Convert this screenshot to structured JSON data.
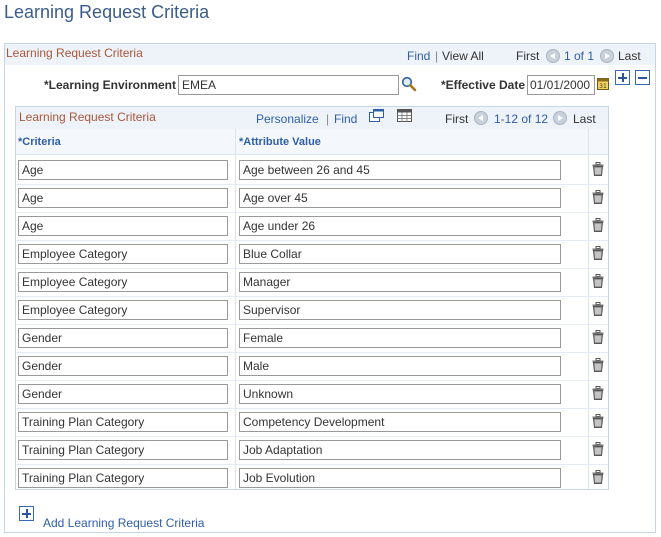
{
  "page": {
    "title": "Learning Request Criteria"
  },
  "outer": {
    "title": "Learning Request Criteria",
    "find": "Find",
    "separator": "|",
    "view_all": "View All",
    "first": "First",
    "range": "1 of 1",
    "last": "Last"
  },
  "fields": {
    "learning_environment_label": "*Learning Environment",
    "learning_environment_value": "EMEA",
    "effective_date_label": "*Effective Date",
    "effective_date_value": "01/01/2000"
  },
  "grid": {
    "title": "Learning Request Criteria",
    "personalize": "Personalize",
    "separator": "|",
    "find": "Find",
    "first": "First",
    "range": "1-12 of 12",
    "last": "Last",
    "col_criteria": "*Criteria",
    "col_attribute": "*Attribute Value",
    "rows": [
      {
        "criteria": "Age",
        "attribute": "Age between 26 and 45"
      },
      {
        "criteria": "Age",
        "attribute": "Age over 45"
      },
      {
        "criteria": "Age",
        "attribute": "Age under 26"
      },
      {
        "criteria": "Employee Category",
        "attribute": "Blue Collar"
      },
      {
        "criteria": "Employee Category",
        "attribute": "Manager"
      },
      {
        "criteria": "Employee Category",
        "attribute": "Supervisor"
      },
      {
        "criteria": "Gender",
        "attribute": "Female"
      },
      {
        "criteria": "Gender",
        "attribute": "Male"
      },
      {
        "criteria": "Gender",
        "attribute": "Unknown"
      },
      {
        "criteria": "Training Plan Category",
        "attribute": "Competency Development"
      },
      {
        "criteria": "Training Plan Category",
        "attribute": "Job Adaptation"
      },
      {
        "criteria": "Training Plan Category",
        "attribute": "Job Evolution"
      }
    ]
  },
  "footer": {
    "add_label": "Add Learning Request Criteria"
  },
  "icons": {
    "lookup": "magnifier-icon",
    "calendar": "calendar-icon",
    "add_row": "plus-icon",
    "delete_row": "minus-icon",
    "zoom": "new-window-icon",
    "download": "grid-download-icon",
    "row_delete": "trash-icon"
  },
  "colors": {
    "title": "#3a5c8a",
    "link": "#2f5ea8",
    "section_title": "#a8573a",
    "header_bg": "#eef3f9"
  }
}
